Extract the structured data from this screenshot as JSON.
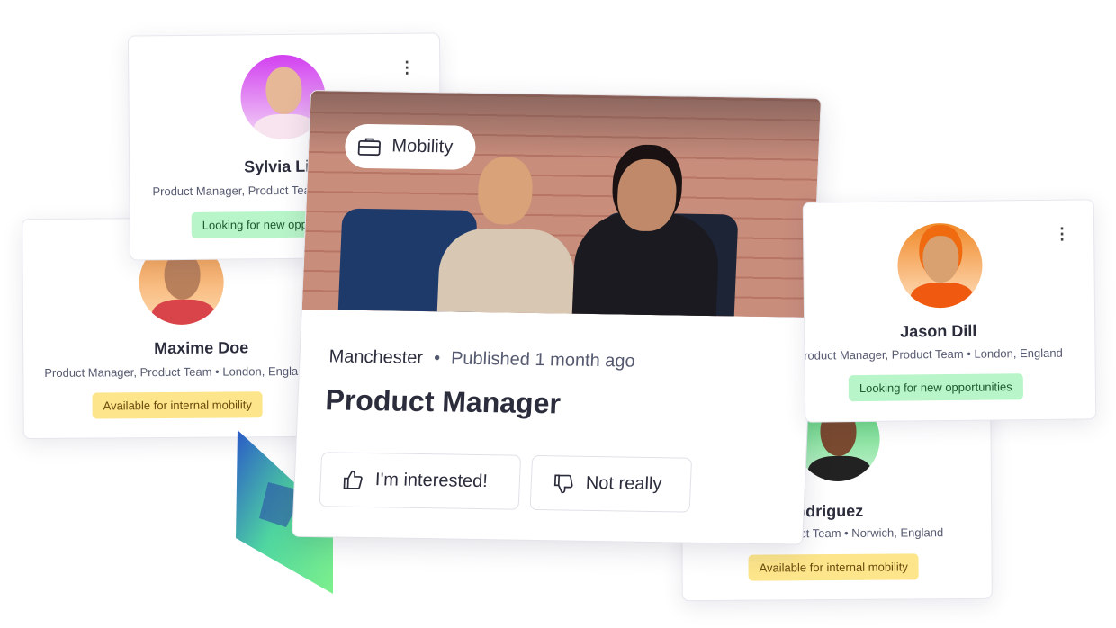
{
  "profiles": [
    {
      "name": "Sylvia Lin",
      "subtitle": "Product Manager, Product Team",
      "badge": "Looking for new opportunities",
      "badge_color": "#b8f5c8",
      "avatar_bg": "#d85cf0"
    },
    {
      "name": "Maxime Doe",
      "subtitle": "Product Manager, Product Team  •  London, England",
      "badge": "Available for internal mobility",
      "badge_color": "#fce58a",
      "avatar_bg": "#f2a05a"
    },
    {
      "name": "Jason Dill",
      "subtitle": "Product Manager, Product Team  •  London, England",
      "badge": "Looking for new opportunities",
      "badge_color": "#b8f5c8",
      "avatar_bg": "#f08a2a"
    },
    {
      "name": "Alicia Rodriguez",
      "subtitle": "Product Manager, Product Team  •  Norwich, England",
      "badge": "Available for internal mobility",
      "badge_color": "#fce58a",
      "avatar_bg": "#5fd67e"
    }
  ],
  "job": {
    "tag": "Mobility",
    "tag_icon": "briefcase-icon",
    "location": "Manchester",
    "separator": "•",
    "published": "Published 1 month ago",
    "title": "Product Manager",
    "interested_label": "I'm interested!",
    "not_really_label": "Not really"
  }
}
